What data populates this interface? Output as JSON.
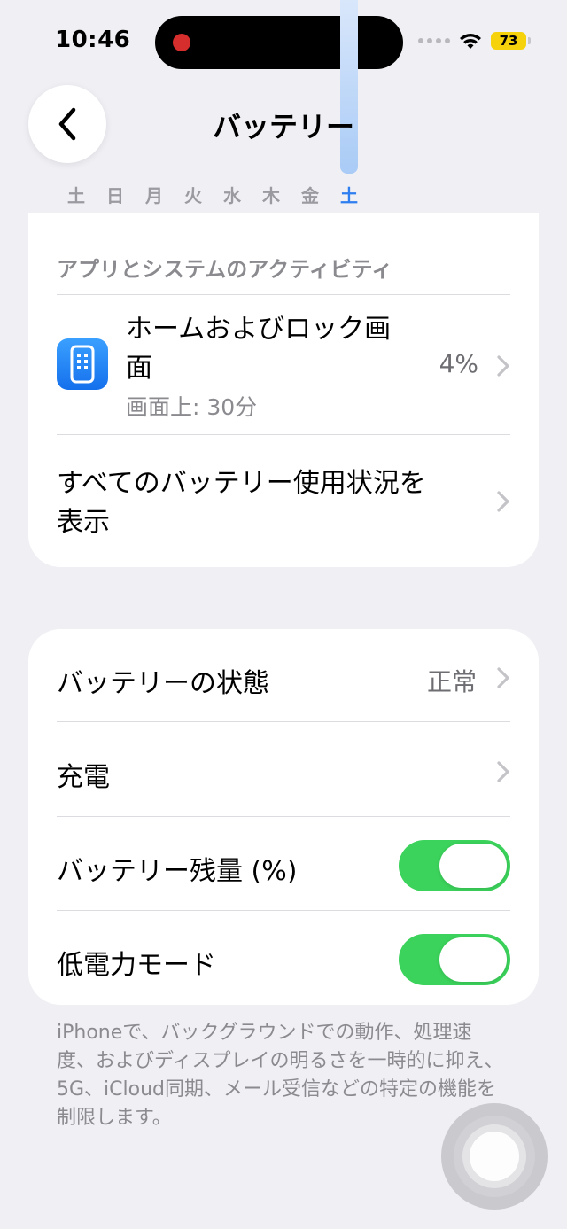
{
  "status_bar": {
    "time": "10:46",
    "battery_level": "73",
    "battery_color": "#f5d20b",
    "recording_color": "#d62d2d"
  },
  "header": {
    "title": "バッテリー",
    "back_icon": "chevron-left-icon"
  },
  "weekdays": {
    "items": [
      "土",
      "日",
      "月",
      "火",
      "水",
      "木",
      "金",
      "土"
    ],
    "selected_index": 7,
    "accent_color": "#2f7ef0"
  },
  "activity": {
    "section_header": "アプリとシステムのアクティビティ",
    "app": {
      "name": "ホームおよびロック画面",
      "subtitle": "画面上: 30分",
      "percent": "4%",
      "icon": "home-lock-screen-icon"
    },
    "show_all_label": "すべてのバッテリー使用状況を表示"
  },
  "settings": {
    "battery_health": {
      "label": "バッテリーの状態",
      "value": "正常"
    },
    "charging": {
      "label": "充電"
    },
    "battery_percentage": {
      "label": "バッテリー残量 (%)",
      "enabled": true
    },
    "low_power_mode": {
      "label": "低電力モード",
      "enabled": true
    },
    "toggle_on_color": "#3bd35b"
  },
  "footnote": "iPhoneで、バックグラウンドでの動作、処理速度、およびディスプレイの明るさを一時的に抑え、5G、iCloud同期、メール受信などの特定の機能を制限します。"
}
